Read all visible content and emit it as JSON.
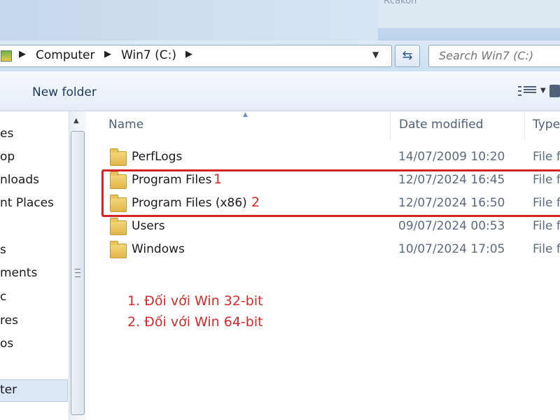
{
  "title_glimpse": "Rcakon",
  "address": {
    "crumbs": [
      "Computer",
      "Win7 (C:)"
    ],
    "search_placeholder": "Search Win7 (C:)"
  },
  "toolbar": {
    "new_folder_label": "New folder"
  },
  "nav_pane": {
    "items": [
      "es",
      "op",
      "nloads",
      "nt Places",
      "s",
      "ments",
      "c",
      "res",
      "os",
      "ter"
    ],
    "selected_index": 9
  },
  "columns": {
    "name": "Name",
    "date": "Date modified",
    "type": "Type"
  },
  "files": [
    {
      "name": "PerfLogs",
      "date": "14/07/2009 10:20",
      "type": "File f",
      "annotation": ""
    },
    {
      "name": "Program Files",
      "date": "12/07/2024 16:45",
      "type": "File f",
      "annotation": "1"
    },
    {
      "name": "Program Files (x86)",
      "date": "12/07/2024 16:50",
      "type": "File f",
      "annotation": "2"
    },
    {
      "name": "Users",
      "date": "09/07/2024 00:53",
      "type": "File f",
      "annotation": ""
    },
    {
      "name": "Windows",
      "date": "10/07/2024 17:05",
      "type": "File f",
      "annotation": ""
    }
  ],
  "notes": [
    "1. Đối với Win 32-bit",
    "2. Đối với Win 64-bit"
  ],
  "colors": {
    "annotation": "#d42a2a",
    "folder": "#e2b64a",
    "selection": "#dbe7f5"
  }
}
